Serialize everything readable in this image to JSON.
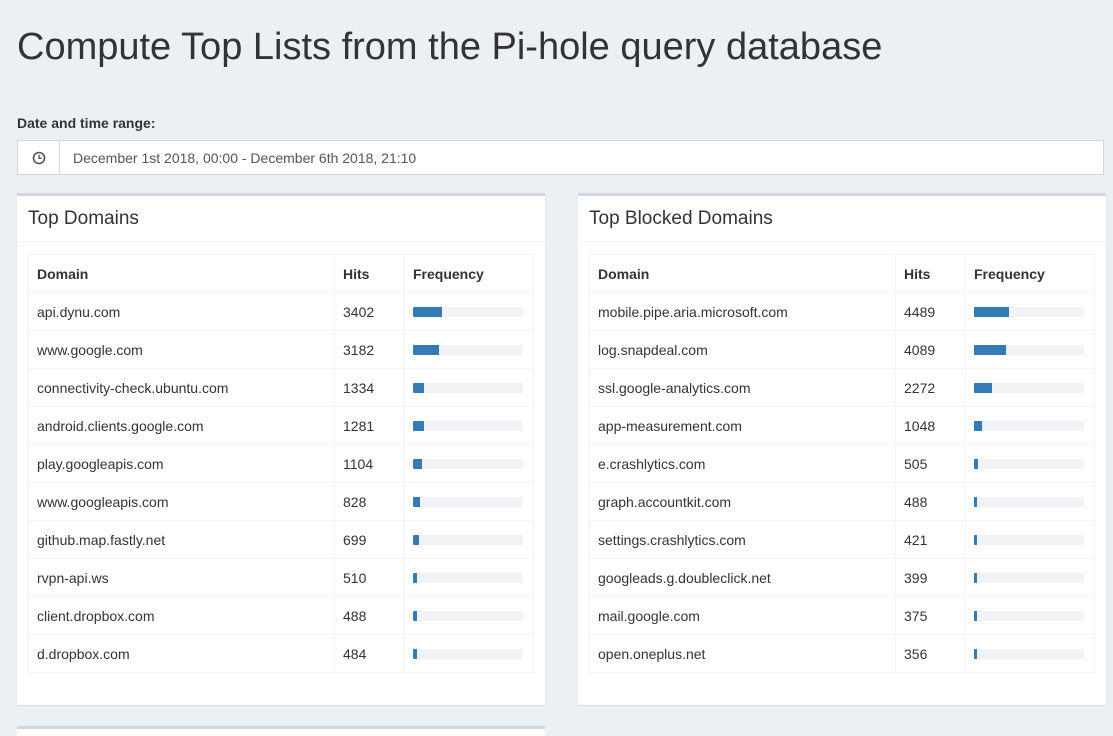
{
  "page": {
    "title": "Compute Top Lists from the Pi-hole query database"
  },
  "range": {
    "label": "Date and time range:",
    "value": "December 1st 2018, 00:00 - December 6th 2018, 21:10",
    "icon": "clock-icon"
  },
  "colors": {
    "bar": "#337ab7",
    "bar_track": "#f0f2f5",
    "box_border": "#d2d6de",
    "background": "#ecf0f5"
  },
  "top_domains": {
    "title": "Top Domains",
    "headers": {
      "domain": "Domain",
      "hits": "Hits",
      "frequency": "Frequency"
    },
    "rows": [
      {
        "domain": "api.dynu.com",
        "hits": "3402",
        "frequency": 0.26
      },
      {
        "domain": "www.google.com",
        "hits": "3182",
        "frequency": 0.24
      },
      {
        "domain": "connectivity-check.ubuntu.com",
        "hits": "1334",
        "frequency": 0.1
      },
      {
        "domain": "android.clients.google.com",
        "hits": "1281",
        "frequency": 0.1
      },
      {
        "domain": "play.googleapis.com",
        "hits": "1104",
        "frequency": 0.08
      },
      {
        "domain": "www.googleapis.com",
        "hits": "828",
        "frequency": 0.06
      },
      {
        "domain": "github.map.fastly.net",
        "hits": "699",
        "frequency": 0.05
      },
      {
        "domain": "rvpn-api.ws",
        "hits": "510",
        "frequency": 0.04
      },
      {
        "domain": "client.dropbox.com",
        "hits": "488",
        "frequency": 0.04
      },
      {
        "domain": "d.dropbox.com",
        "hits": "484",
        "frequency": 0.04
      }
    ]
  },
  "top_blocked": {
    "title": "Top Blocked Domains",
    "headers": {
      "domain": "Domain",
      "hits": "Hits",
      "frequency": "Frequency"
    },
    "rows": [
      {
        "domain": "mobile.pipe.aria.microsoft.com",
        "hits": "4489",
        "frequency": 0.32
      },
      {
        "domain": "log.snapdeal.com",
        "hits": "4089",
        "frequency": 0.29
      },
      {
        "domain": "ssl.google-analytics.com",
        "hits": "2272",
        "frequency": 0.16
      },
      {
        "domain": "app-measurement.com",
        "hits": "1048",
        "frequency": 0.07
      },
      {
        "domain": "e.crashlytics.com",
        "hits": "505",
        "frequency": 0.04
      },
      {
        "domain": "graph.accountkit.com",
        "hits": "488",
        "frequency": 0.03
      },
      {
        "domain": "settings.crashlytics.com",
        "hits": "421",
        "frequency": 0.03
      },
      {
        "domain": "googleads.g.doubleclick.net",
        "hits": "399",
        "frequency": 0.03
      },
      {
        "domain": "mail.google.com",
        "hits": "375",
        "frequency": 0.03
      },
      {
        "domain": "open.oneplus.net",
        "hits": "356",
        "frequency": 0.03
      }
    ]
  }
}
